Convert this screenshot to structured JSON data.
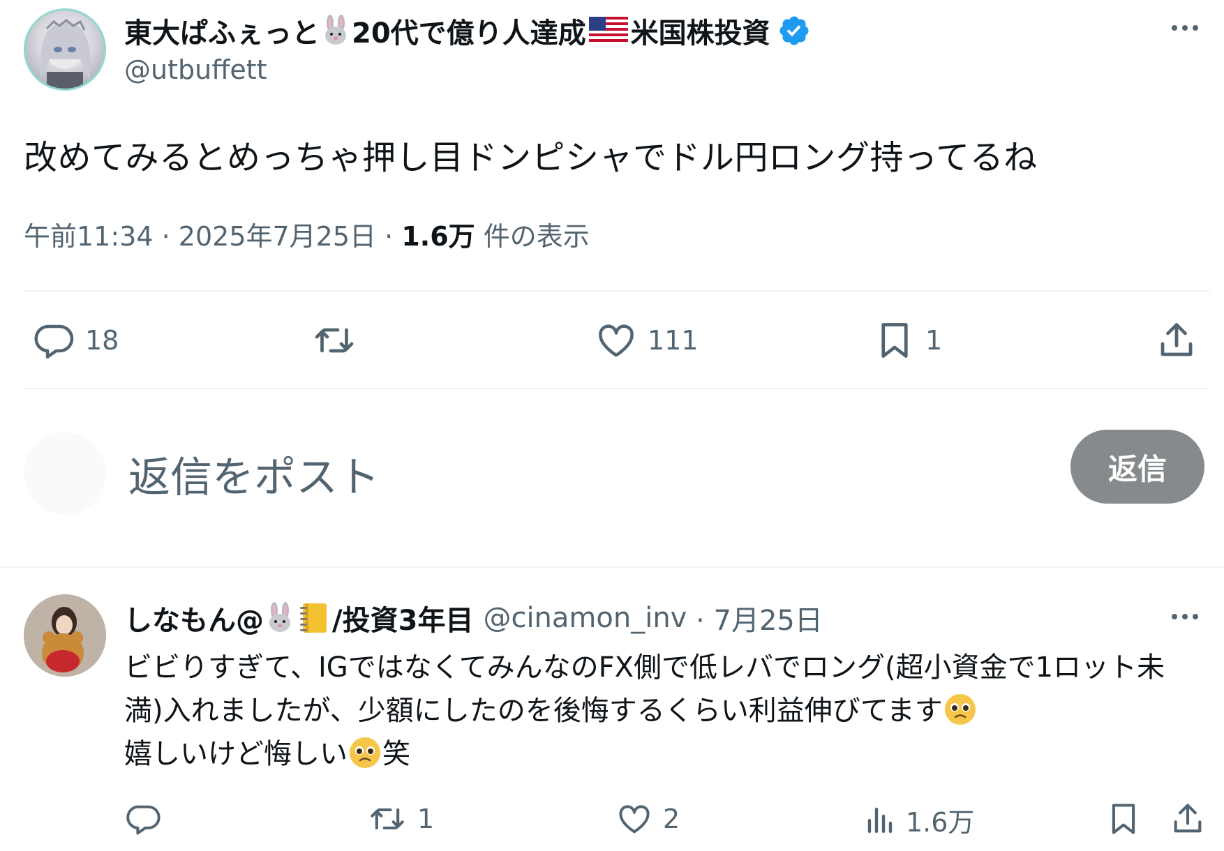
{
  "main_tweet": {
    "author": {
      "name_parts": [
        "東大ぱふぇっと",
        "20代で億り人達成",
        "米国株投資"
      ],
      "handle": "@utbuffett",
      "verified": true,
      "emojis": [
        "rabbit-face",
        "us-flag"
      ]
    },
    "text": "改めてみるとめっちゃ押し目ドンピシャでドル円ロング持ってるね",
    "time": "午前11:34",
    "separator": "·",
    "date": "2025年7月25日",
    "views_count": "1.6万",
    "views_label": "件の表示",
    "actions": {
      "replies": "18",
      "reposts": "",
      "likes": "111",
      "bookmarks": "1"
    }
  },
  "reply_composer": {
    "placeholder": "返信をポスト",
    "button_label": "返信"
  },
  "reply_tweet": {
    "author": {
      "name_prefix": "しなもん@",
      "name_suffix": "/投資3年目",
      "handle": "@cinamon_inv",
      "separator": "·",
      "date": "7月25日",
      "emojis": [
        "rabbit-face",
        "notebook"
      ]
    },
    "text_part1": "ビビりすぎて、IGではなくてみんなのFX側で低レバでロング(超小資金で1ロット未満)入れましたが、少額にしたのを後悔するくらい利益伸びてます",
    "text_part2": "嬉しいけど悔しい",
    "text_part3": "笑",
    "actions": {
      "replies": "",
      "reposts": "1",
      "likes": "2",
      "views": "1.6万"
    }
  },
  "colors": {
    "text_primary": "#0f1419",
    "text_secondary": "#536471",
    "verified_blue": "#1d9bf0",
    "divider": "#eff3f4",
    "reply_button_bg": "#878a8c"
  }
}
